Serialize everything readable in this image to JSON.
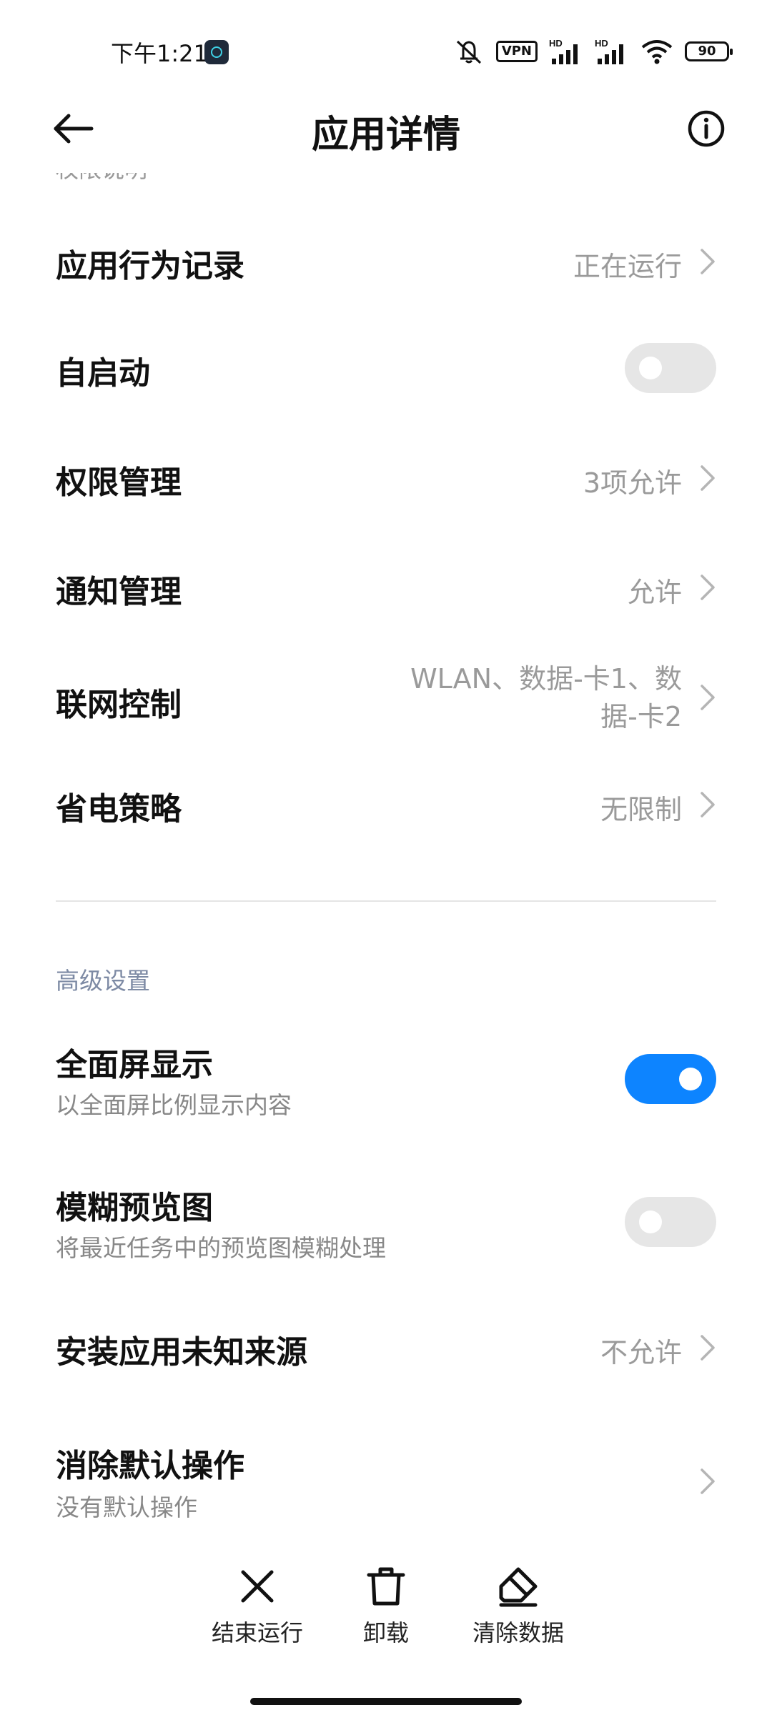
{
  "status_bar": {
    "time": "下午1:21",
    "vpn": "VPN",
    "hd1": "HD",
    "hd2": "HD",
    "battery": "90"
  },
  "header": {
    "title": "应用详情"
  },
  "clipped_text": "权限说明",
  "rows": {
    "behavior_record": {
      "label": "应用行为记录",
      "value": "正在运行"
    },
    "autostart": {
      "label": "自启动",
      "enabled": false
    },
    "permissions": {
      "label": "权限管理",
      "value": "3项允许"
    },
    "notifications": {
      "label": "通知管理",
      "value": "允许"
    },
    "network": {
      "label": "联网控制",
      "value": "WLAN、数据-卡1、数据-卡2"
    },
    "battery_saver": {
      "label": "省电策略",
      "value": "无限制"
    }
  },
  "advanced": {
    "section_title": "高级设置",
    "fullscreen": {
      "label": "全面屏显示",
      "sub": "以全面屏比例显示内容",
      "enabled": true
    },
    "blur_preview": {
      "label": "模糊预览图",
      "sub": "将最近任务中的预览图模糊处理",
      "enabled": false
    },
    "unknown_sources": {
      "label": "安装应用未知来源",
      "value": "不允许"
    },
    "clear_defaults": {
      "label": "消除默认操作",
      "sub": "没有默认操作"
    }
  },
  "toolbar": {
    "stop_label": "结束运行",
    "uninstall_label": "卸载",
    "clear_data_label": "清除数据"
  },
  "colors": {
    "accent": "#0d84ff",
    "section_title": "#7d8aa4",
    "secondary_text": "#9a9a9a"
  }
}
